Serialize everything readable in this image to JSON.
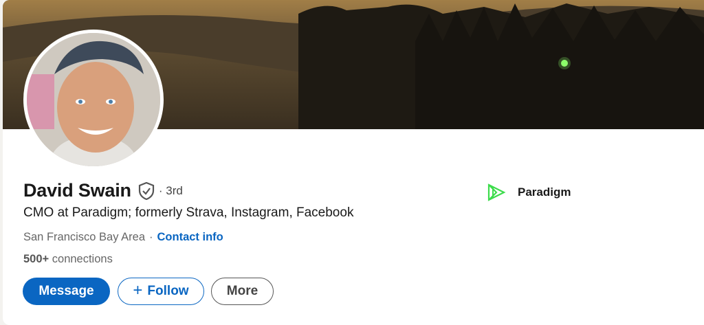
{
  "profile": {
    "name": "David Swain",
    "degree": "· 3rd",
    "headline": "CMO at Paradigm; formerly Strava, Instagram, Facebook",
    "location": "San Francisco Bay Area",
    "separator": "·",
    "contact_label": "Contact info",
    "connections_count": "500+",
    "connections_label": "connections"
  },
  "actions": {
    "message_label": "Message",
    "follow_label": "Follow",
    "follow_icon": "+",
    "more_label": "More"
  },
  "company": {
    "name": "Paradigm",
    "logo_icon": "paradigm-logo-icon",
    "logo_color": "#3ddc4c"
  },
  "colors": {
    "accent": "#0a66c2",
    "text": "#191919",
    "muted": "#666666"
  }
}
